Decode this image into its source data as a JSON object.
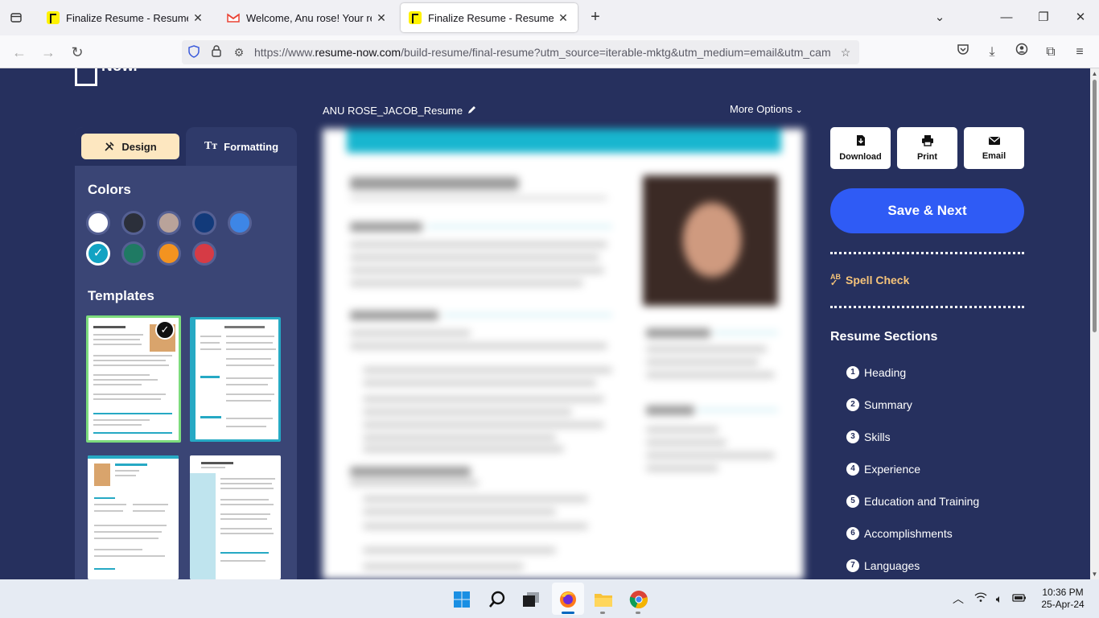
{
  "browser": {
    "tabs": [
      {
        "title": "Finalize Resume - Resume Now",
        "active": false
      },
      {
        "title": "Welcome, Anu rose! Your resum",
        "active": false
      },
      {
        "title": "Finalize Resume - Resume Now",
        "active": true
      }
    ],
    "url_prefix": "https://www.",
    "url_host": "resume-now.com",
    "url_path": "/build-resume/final-resume?utm_source=iterable-mktg&utm_medium=email&utm_cam"
  },
  "logo": {
    "text": "Now."
  },
  "left_panel": {
    "design_tab": "Design",
    "formatting_tab": "Formatting",
    "colors_title": "Colors",
    "templates_title": "Templates",
    "colors": [
      "#ffffff",
      "#2b2f3a",
      "#b9a39a",
      "#123a7a",
      "#3d86e6",
      "#12a3c3",
      "#1f7a63",
      "#f39320",
      "#d63b45"
    ],
    "selected_color": "#12a3c3"
  },
  "preview": {
    "doc_name": "ANU ROSE_JACOB_Resume",
    "more_options": "More Options"
  },
  "actions": {
    "download": "Download",
    "print": "Print",
    "email": "Email",
    "save_next": "Save & Next",
    "spell_check": "Spell Check",
    "spell_prefix": "AB"
  },
  "resume_sections": {
    "title": "Resume Sections",
    "items": [
      {
        "num": "1",
        "label": "Heading"
      },
      {
        "num": "2",
        "label": "Summary"
      },
      {
        "num": "3",
        "label": "Skills"
      },
      {
        "num": "4",
        "label": "Experience"
      },
      {
        "num": "5",
        "label": "Education and Training"
      },
      {
        "num": "6",
        "label": "Accomplishments"
      },
      {
        "num": "7",
        "label": "Languages"
      }
    ]
  },
  "taskbar": {
    "time": "10:36 PM",
    "date": "25-Apr-24"
  }
}
